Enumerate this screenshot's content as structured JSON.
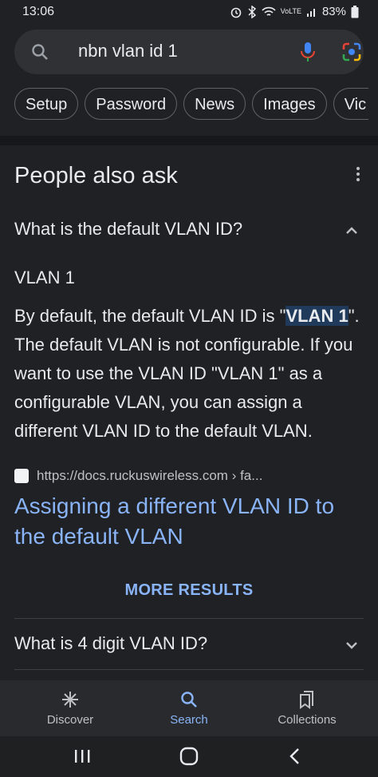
{
  "status": {
    "time": "13:06",
    "network": "VoLTE",
    "battery": "83%"
  },
  "search": {
    "query": "nbn vlan id 1"
  },
  "chips": [
    "Setup",
    "Password",
    "News",
    "Images",
    "Vic"
  ],
  "paa": {
    "title": "People also ask",
    "q1": "What is the default VLAN ID?",
    "short_answer": "VLAN 1",
    "body_pre": "By default, the default VLAN ID is \"",
    "body_hl": "VLAN 1",
    "body_post": "\". The default VLAN is not configurable. If you want to use the VLAN ID \"VLAN 1\" as a configurable VLAN, you can assign a different VLAN ID to the default VLAN.",
    "source_url": "https://docs.ruckuswireless.com › fa...",
    "link_title": "Assigning a different VLAN ID to the default VLAN",
    "more_results": "MORE RESULTS",
    "q2": "What is 4 digit VLAN ID?"
  },
  "bottom_nav": {
    "discover": "Discover",
    "search": "Search",
    "collections": "Collections"
  },
  "colors": {
    "bg": "#202124",
    "link": "#8ab4f8",
    "text": "#e8eaed"
  }
}
